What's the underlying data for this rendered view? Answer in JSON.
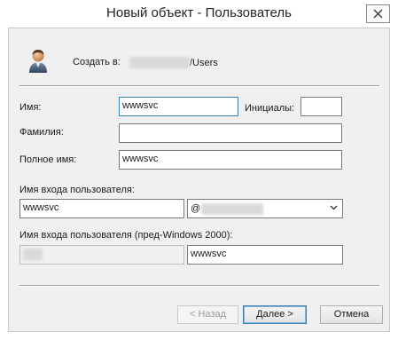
{
  "window": {
    "title": "Новый объект - Пользователь",
    "close_glyph": "✕"
  },
  "header": {
    "icon": "user-icon",
    "create_in_label": "Создать в:",
    "create_in_path_suffix": "/Users"
  },
  "form": {
    "first_name_label": "Имя:",
    "first_name_value": "wwwsvc",
    "initials_label": "Инициалы:",
    "initials_value": "",
    "last_name_label": "Фамилия:",
    "last_name_value": "",
    "full_name_label": "Полное имя:",
    "full_name_value": "wwwsvc",
    "logon_name_label": "Имя входа пользователя:",
    "logon_name_value": "wwwsvc",
    "domain_prefix": "@",
    "pre2000_label": "Имя входа пользователя (пред-Windows 2000):",
    "pre2000_name_value": "wwwsvc"
  },
  "buttons": {
    "back_label": "< Назад",
    "next_label": "Далее >",
    "cancel_label": "Отмена"
  }
}
